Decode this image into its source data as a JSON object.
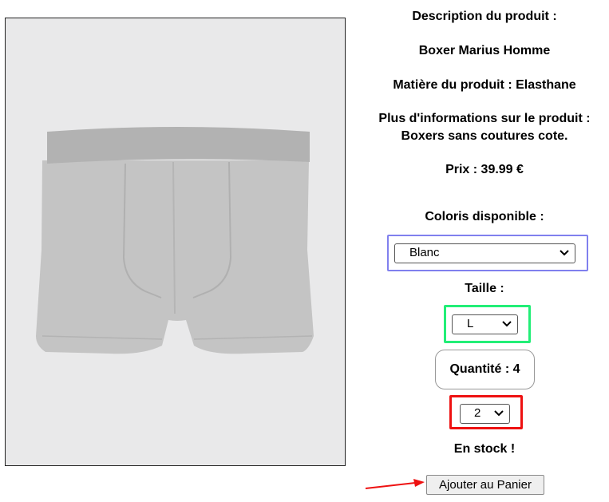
{
  "product": {
    "description_heading": "Description du produit :",
    "name": "Boxer Marius Homme",
    "material": "Matière du produit : Elasthane",
    "more_info_heading": "Plus d'informations sur le produit :",
    "more_info_text": "Boxers sans coutures cote.",
    "price": "Prix : 39.99 €"
  },
  "color": {
    "label": "Coloris disponible :",
    "selected": "Blanc",
    "highlight": "#8080ee"
  },
  "size": {
    "label": "Taille :",
    "selected": "L",
    "highlight": "#22ee77"
  },
  "quantity": {
    "label": "Quantité : 4",
    "selected": "2",
    "highlight": "#ee1111"
  },
  "stock": "En stock !",
  "cart": {
    "button_label": "Ajouter au Panier",
    "arrow_color": "#ee1111"
  },
  "icons": {
    "dropdown": "chevron-down-icon",
    "pointer": "arrow-right-icon"
  }
}
